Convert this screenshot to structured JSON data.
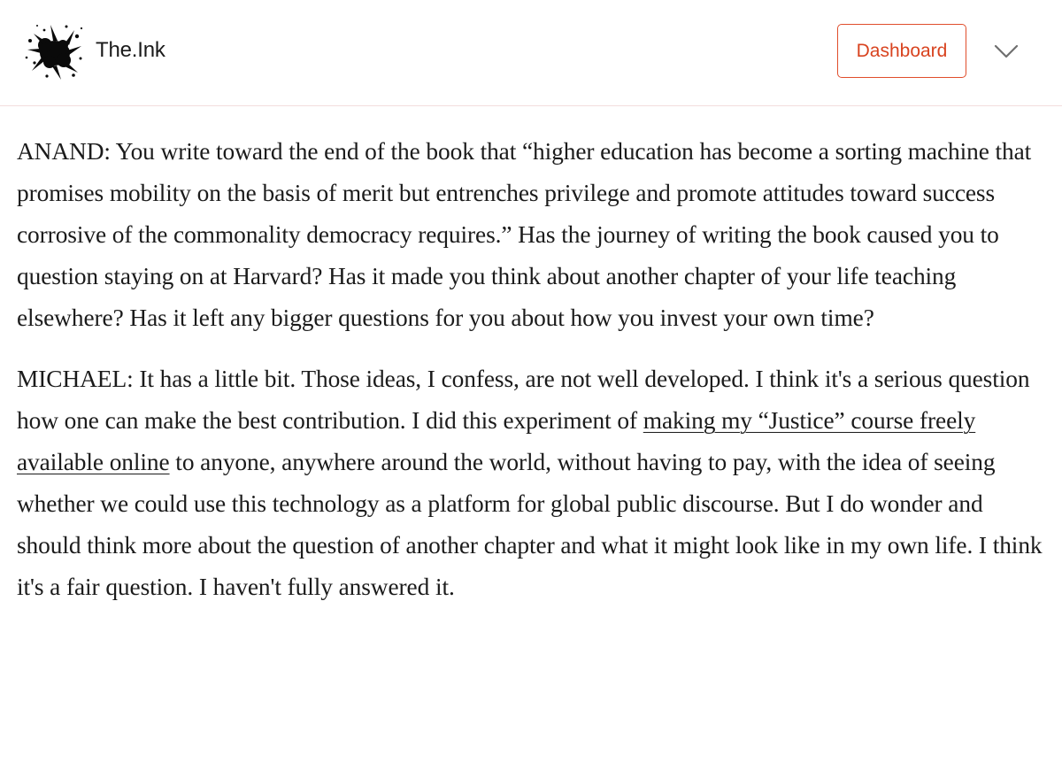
{
  "header": {
    "logo_icon": "ink-splat-icon",
    "publication_name": "The.Ink",
    "dashboard_label": "Dashboard",
    "menu_icon": "chevron-down-icon",
    "accent_color": "#e04e2c"
  },
  "article": {
    "paragraph_1": {
      "text": "ANAND: You write toward the end of the book that “higher education has become a sorting machine that promises mobility on the basis of merit but entrenches privilege and promote attitudes toward success corrosive of the commonality democracy requires.” Has the journey of writing the book caused you to question staying on at Harvard? Has it made you think about another chapter of your life teaching elsewhere? Has it left any bigger questions for you about how you invest your own time?"
    },
    "paragraph_2": {
      "text_before_link": "MICHAEL: It has a little bit. Those ideas, I confess, are not well developed. I think it's a serious question how one can make the best contribution. I did this experiment of ",
      "link_text": "making my “Justice” course freely available online",
      "text_after_link": " to anyone, anywhere around the world, without having to pay, with the idea of seeing whether we could use this technology as a platform for global public discourse. But I do wonder and should think more about the question of another chapter and what it might look like in my own life. I think it's a fair question. I haven't fully answered it."
    }
  }
}
